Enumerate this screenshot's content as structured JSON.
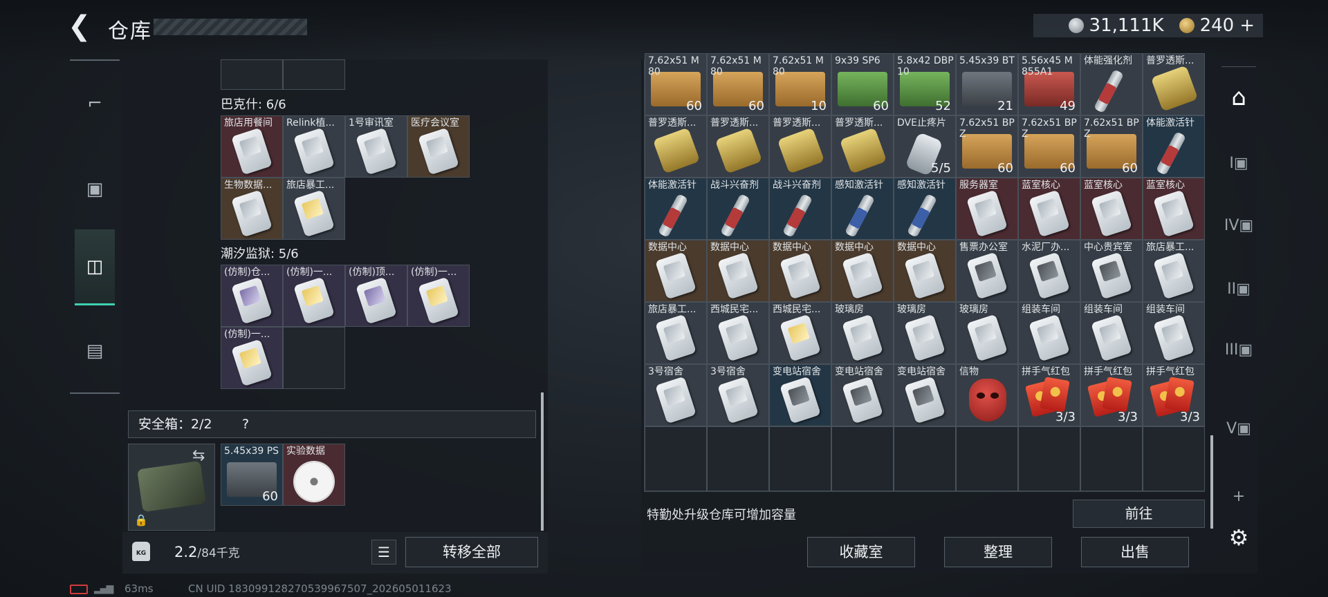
{
  "header": {
    "back": "❮",
    "title": "仓库"
  },
  "currency": {
    "silver": "31,111K",
    "gold": "240",
    "add": "+"
  },
  "left_nav": [
    {
      "name": "weapons",
      "icon": "pistol-icon"
    },
    {
      "name": "armor",
      "icon": "vest-icon"
    },
    {
      "name": "backpack",
      "icon": "backpack-icon"
    },
    {
      "name": "briefcase",
      "icon": "briefcase-icon"
    }
  ],
  "left_panel": {
    "sections": [
      {
        "title": "巴克什: 6/6",
        "items": [
          {
            "name": "旅店用餐间",
            "bg": "red",
            "art": "card"
          },
          {
            "name": "Relink植...",
            "bg": "grey",
            "art": "card"
          },
          {
            "name": "1号审讯室",
            "bg": "grey",
            "art": "card"
          },
          {
            "name": "医疗会议室",
            "bg": "brown",
            "art": "card"
          },
          {
            "name": "生物数据...",
            "bg": "brown",
            "art": "card"
          },
          {
            "name": "旅店暴工...",
            "bg": "grey",
            "art": "card gold"
          }
        ]
      },
      {
        "title": "潮汐监狱: 5/6",
        "items": [
          {
            "name": "(仿制)仓...",
            "bg": "purple",
            "art": "card purple"
          },
          {
            "name": "(仿制)一...",
            "bg": "purple",
            "art": "card gold"
          },
          {
            "name": "(仿制)顶...",
            "bg": "purple",
            "art": "card purple"
          },
          {
            "name": "(仿制)一...",
            "bg": "purple",
            "art": "card gold"
          },
          {
            "name": "(仿制)一...",
            "bg": "purple",
            "art": "card gold"
          },
          {
            "name": "",
            "bg": "empty",
            "art": ""
          }
        ]
      }
    ],
    "safe_box": {
      "label": "安全箱：2/2",
      "help": "?",
      "swap": "⇆",
      "lock": "🔒",
      "items": [
        {
          "name": "5.45x39 PS",
          "count": "60",
          "bg": "blue",
          "art": "ammo grey"
        },
        {
          "name": "实验数据",
          "count": "",
          "bg": "red",
          "art": "disc"
        }
      ]
    },
    "footer": {
      "weight_icon": "KG",
      "weight_value": "2.2",
      "weight_max": "/84千克",
      "list": "☰",
      "transfer_all": "转移全部"
    }
  },
  "storage": {
    "rows": [
      [
        {
          "name": "7.62x51 M80",
          "count": "60",
          "bg": "grey",
          "art": "ammo"
        },
        {
          "name": "7.62x51 M80",
          "count": "60",
          "bg": "grey",
          "art": "ammo"
        },
        {
          "name": "7.62x51 M80",
          "count": "10",
          "bg": "grey",
          "art": "ammo"
        },
        {
          "name": "9x39 SP6",
          "count": "60",
          "bg": "grey",
          "art": "ammo green"
        },
        {
          "name": "5.8x42 DBP10",
          "count": "52",
          "bg": "grey",
          "art": "ammo green"
        },
        {
          "name": "5.45x39 BT",
          "count": "21",
          "bg": "grey",
          "art": "ammo grey"
        },
        {
          "name": "5.56x45 M855A1",
          "count": "49",
          "bg": "grey",
          "art": "ammo red"
        },
        {
          "name": "体能强化剂",
          "count": "",
          "bg": "grey",
          "art": "inj red"
        },
        {
          "name": "普罗透斯...",
          "count": "",
          "bg": "grey",
          "art": "pkg gold"
        }
      ],
      [
        {
          "name": "普罗透斯...",
          "count": "",
          "bg": "grey",
          "art": "pkg gold"
        },
        {
          "name": "普罗透斯...",
          "count": "",
          "bg": "grey",
          "art": "pkg gold"
        },
        {
          "name": "普罗透斯...",
          "count": "",
          "bg": "grey",
          "art": "pkg gold"
        },
        {
          "name": "普罗透斯...",
          "count": "",
          "bg": "grey",
          "art": "pkg gold"
        },
        {
          "name": "DVE止疼片",
          "count": "5/5",
          "bg": "grey",
          "art": "pills"
        },
        {
          "name": "7.62x51 BPZ",
          "count": "60",
          "bg": "grey",
          "art": "ammo"
        },
        {
          "name": "7.62x51 BPZ",
          "count": "60",
          "bg": "grey",
          "art": "ammo"
        },
        {
          "name": "7.62x51 BPZ",
          "count": "60",
          "bg": "grey",
          "art": "ammo"
        },
        {
          "name": "体能激活针",
          "count": "",
          "bg": "blue",
          "art": "inj red"
        }
      ],
      [
        {
          "name": "体能激活针",
          "count": "",
          "bg": "blue",
          "art": "inj red"
        },
        {
          "name": "战斗兴奋剂",
          "count": "",
          "bg": "blue",
          "art": "inj red"
        },
        {
          "name": "战斗兴奋剂",
          "count": "",
          "bg": "blue",
          "art": "inj red"
        },
        {
          "name": "感知激活针",
          "count": "",
          "bg": "blue",
          "art": "inj blue"
        },
        {
          "name": "感知激活针",
          "count": "",
          "bg": "blue",
          "art": "inj blue"
        },
        {
          "name": "服务器室",
          "count": "",
          "bg": "red",
          "art": "card"
        },
        {
          "name": "蓝室核心",
          "count": "",
          "bg": "red",
          "art": "card"
        },
        {
          "name": "蓝室核心",
          "count": "",
          "bg": "red",
          "art": "card"
        },
        {
          "name": "蓝室核心",
          "count": "",
          "bg": "red",
          "art": "card"
        }
      ],
      [
        {
          "name": "数据中心",
          "count": "",
          "bg": "brown",
          "art": "card"
        },
        {
          "name": "数据中心",
          "count": "",
          "bg": "brown",
          "art": "card"
        },
        {
          "name": "数据中心",
          "count": "",
          "bg": "brown",
          "art": "card"
        },
        {
          "name": "数据中心",
          "count": "",
          "bg": "brown",
          "art": "card"
        },
        {
          "name": "数据中心",
          "count": "",
          "bg": "brown",
          "art": "card"
        },
        {
          "name": "售票办公室",
          "count": "",
          "bg": "grey",
          "art": "card dark"
        },
        {
          "name": "水泥厂办...",
          "count": "",
          "bg": "grey",
          "art": "card dark"
        },
        {
          "name": "中心贵宾室",
          "count": "",
          "bg": "grey",
          "art": "card dark"
        },
        {
          "name": "旅店暴工...",
          "count": "",
          "bg": "grey",
          "art": "card"
        }
      ],
      [
        {
          "name": "旅店暴工...",
          "count": "",
          "bg": "grey",
          "art": "card"
        },
        {
          "name": "西城民宅...",
          "count": "",
          "bg": "grey",
          "art": "card"
        },
        {
          "name": "西城民宅...",
          "count": "",
          "bg": "grey",
          "art": "card gold"
        },
        {
          "name": "玻璃房",
          "count": "",
          "bg": "grey",
          "art": "card"
        },
        {
          "name": "玻璃房",
          "count": "",
          "bg": "grey",
          "art": "card"
        },
        {
          "name": "玻璃房",
          "count": "",
          "bg": "grey",
          "art": "card"
        },
        {
          "name": "组装车间",
          "count": "",
          "bg": "grey",
          "art": "card"
        },
        {
          "name": "组装车间",
          "count": "",
          "bg": "grey",
          "art": "card"
        },
        {
          "name": "组装车间",
          "count": "",
          "bg": "grey",
          "art": "card"
        }
      ],
      [
        {
          "name": "3号宿舍",
          "count": "",
          "bg": "grey",
          "art": "card"
        },
        {
          "name": "3号宿舍",
          "count": "",
          "bg": "grey",
          "art": "card"
        },
        {
          "name": "变电站宿舍",
          "count": "",
          "bg": "blue",
          "art": "card dark"
        },
        {
          "name": "变电站宿舍",
          "count": "",
          "bg": "grey",
          "art": "card dark"
        },
        {
          "name": "变电站宿舍",
          "count": "",
          "bg": "grey",
          "art": "card dark"
        },
        {
          "name": "信物",
          "count": "",
          "bg": "grey",
          "art": "mask"
        },
        {
          "name": "拼手气红包",
          "count": "3/3",
          "bg": "grey",
          "art": "redpkt"
        },
        {
          "name": "拼手气红包",
          "count": "3/3",
          "bg": "grey",
          "art": "redpkt"
        },
        {
          "name": "拼手气红包",
          "count": "3/3",
          "bg": "grey",
          "art": "redpkt"
        }
      ]
    ],
    "upgrade_hint": "特勤处升级仓库可增加容量",
    "goto": "前往",
    "actions": [
      "收藏室",
      "整理",
      "出售"
    ]
  },
  "rail": [
    {
      "name": "home",
      "label": "⌂",
      "icon": "depot-icon"
    },
    {
      "name": "I",
      "label": "I▣",
      "icon": "storage-1-icon"
    },
    {
      "name": "IV",
      "label": "IV▣",
      "icon": "storage-4-icon"
    },
    {
      "name": "II",
      "label": "II▣",
      "icon": "storage-2-icon"
    },
    {
      "name": "III",
      "label": "III▣",
      "icon": "storage-3-icon"
    },
    {
      "name": "V",
      "label": "V▣",
      "icon": "storage-5-icon"
    },
    {
      "name": "add",
      "label": "+",
      "icon": "plus-icon"
    },
    {
      "name": "settings",
      "label": "⚙",
      "icon": "gear-icon"
    }
  ],
  "status": {
    "ping": "63ms",
    "uid": "CN UID 1830991282705399675​07_202605011623"
  }
}
